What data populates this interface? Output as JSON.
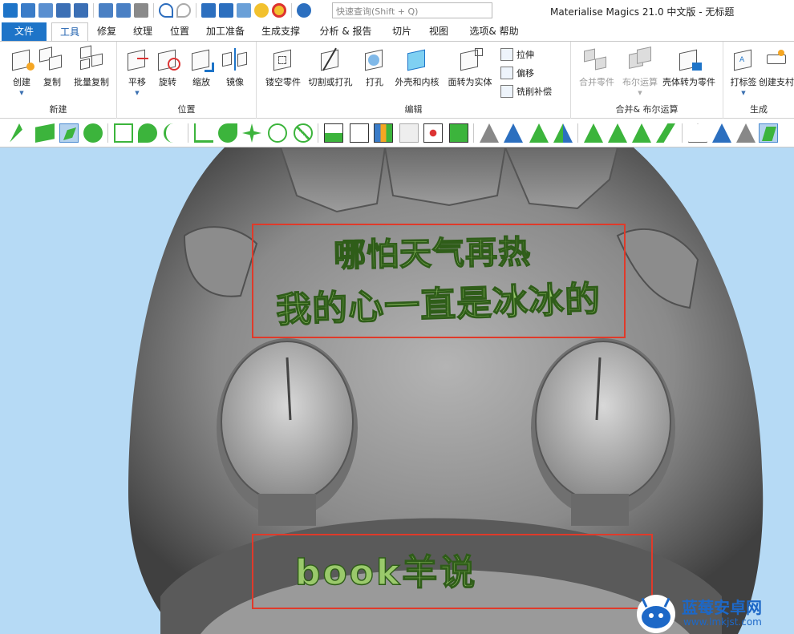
{
  "window": {
    "title": "Materialise Magics 21.0 中文版 - 无标题"
  },
  "search": {
    "placeholder": "快速查询(Shift + Q)"
  },
  "tabs": [
    {
      "label": "文件"
    },
    {
      "label": "工具"
    },
    {
      "label": "修复"
    },
    {
      "label": "纹理"
    },
    {
      "label": "位置"
    },
    {
      "label": "加工准备"
    },
    {
      "label": "生成支撑"
    },
    {
      "label": "分析 & 报告"
    },
    {
      "label": "切片"
    },
    {
      "label": "视图"
    },
    {
      "label": "选项& 帮助"
    }
  ],
  "ribbon": {
    "groups": {
      "new": "新建",
      "position": "位置",
      "edit": "编辑",
      "boolean": "合并& 布尔运算",
      "generate": "生成"
    },
    "buttons": {
      "create": "创建",
      "copy": "复制",
      "batch_copy": "批量复制",
      "translate": "平移",
      "rotate": "旋转",
      "scale": "缩放",
      "mirror": "镜像",
      "hollow_part": "镂空零件",
      "cut_punch": "切割或打孔",
      "punch": "打孔",
      "shell_core": "外壳和内核",
      "surface_to_solid": "面转为实体",
      "extrude": "拉伸",
      "offset": "偏移",
      "mill_comp": "铣削补偿",
      "merge_parts": "合并零件",
      "boolean_op": "布尔运算",
      "shell_to_part": "壳体转为零件",
      "label": "打标签",
      "create_support": "创建支村"
    }
  },
  "model_text": {
    "line1": "哪怕天气再热",
    "line2": "我的心一直是冰冰的",
    "line3": "book羊说"
  },
  "watermark": {
    "title": "蓝莓安卓网",
    "url": "www.lmkjst.com"
  },
  "colors": {
    "accent": "#1e74c8",
    "viewport_bg": "#b6daf5",
    "highlight_box": "#e03a2a",
    "emboss_fill": "#9ac96b"
  }
}
